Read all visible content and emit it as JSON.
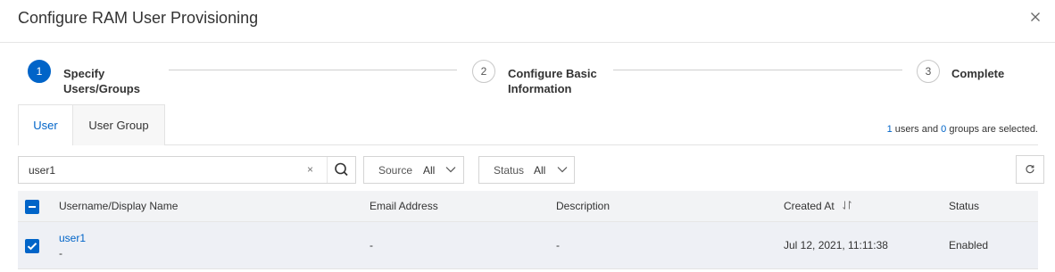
{
  "dialog": {
    "title": "Configure RAM User Provisioning"
  },
  "steps": [
    {
      "number": "1",
      "label_line1": "Specify",
      "label_line2": "Users/Groups",
      "state": "active"
    },
    {
      "number": "2",
      "label_line1": "Configure Basic",
      "label_line2": "Information",
      "state": "inactive"
    },
    {
      "number": "3",
      "label_line1": "Complete",
      "label_line2": "",
      "state": "inactive"
    }
  ],
  "tabs": [
    {
      "label": "User",
      "active": true
    },
    {
      "label": "User Group",
      "active": false
    }
  ],
  "selection": {
    "users_count": "1",
    "text_mid": " users and ",
    "groups_count": "0",
    "text_end": " groups are selected."
  },
  "search": {
    "value": "user1",
    "clear_glyph": "×"
  },
  "filters": [
    {
      "label": "Source",
      "value": "All"
    },
    {
      "label": "Status",
      "value": "All"
    }
  ],
  "table": {
    "columns": [
      "Username/Display Name",
      "Email Address",
      "Description",
      "Created At",
      "Status"
    ],
    "rows": [
      {
        "username": "user1",
        "display_name": "-",
        "email": "-",
        "description": "-",
        "created_at": "Jul 12, 2021, 11:11:38",
        "status": "Enabled",
        "checked": true
      }
    ]
  },
  "colors": {
    "accent": "#0064c8",
    "row_selected": "#eef0f5",
    "header_bg": "#f2f3f5"
  },
  "icons": {
    "close": "close-icon",
    "search": "search-icon",
    "refresh": "refresh-icon",
    "sort": "sort-icon",
    "chevron": "chevron-down-icon"
  }
}
